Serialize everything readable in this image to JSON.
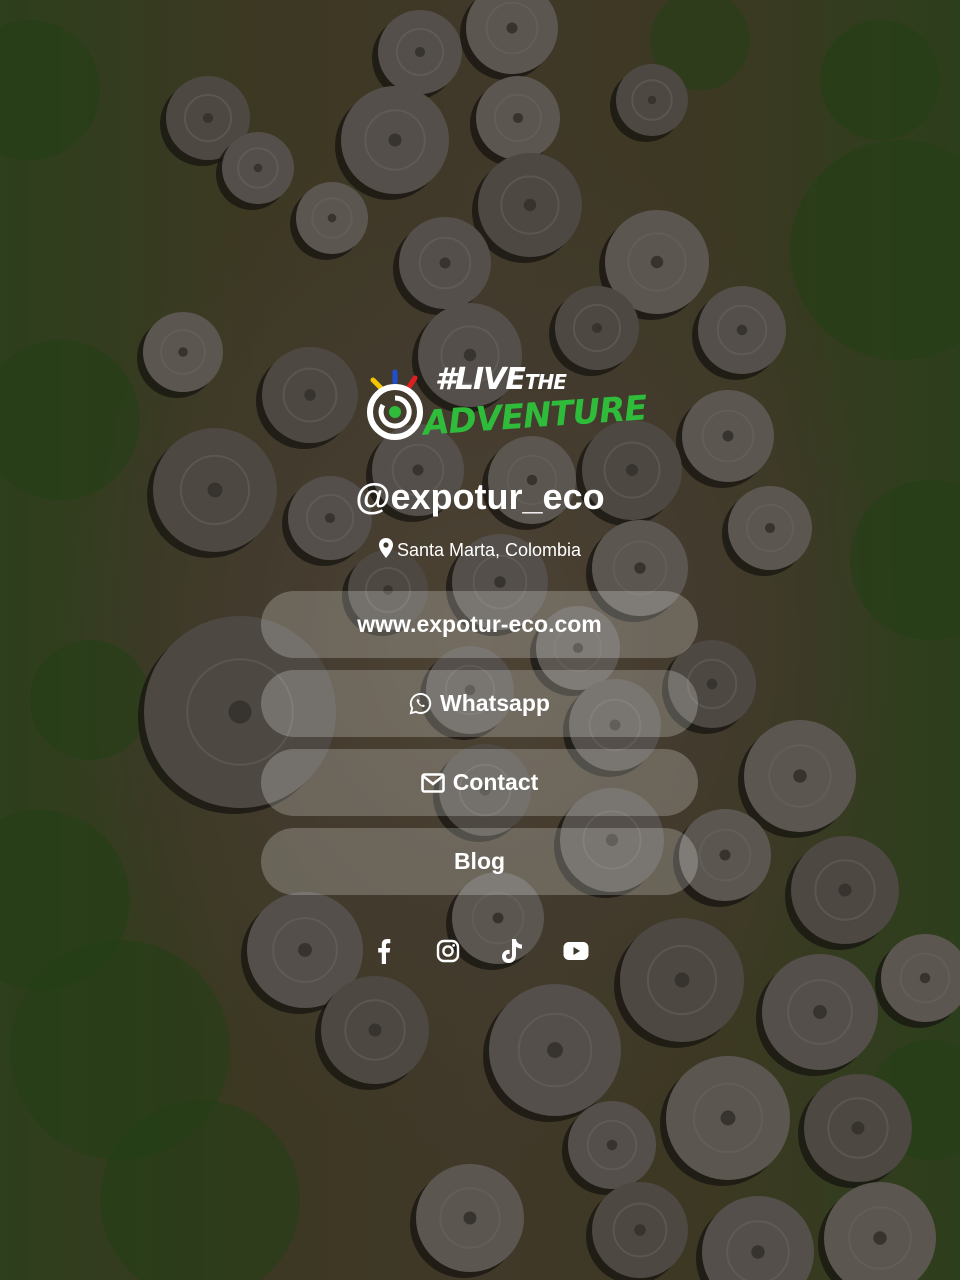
{
  "profile": {
    "logo": {
      "line1": "#LIVE",
      "line1_small": "THE",
      "line2": "ADVENTURE",
      "accent_green": "#2ebc3a"
    },
    "handle": "@expotur_eco",
    "location": "Santa Marta, Colombia",
    "location_icon": "map-pin-icon"
  },
  "links": [
    {
      "label": "www.expotur-eco.com",
      "icon": ""
    },
    {
      "label": "Whatsapp",
      "icon": "whatsapp-icon"
    },
    {
      "label": "Contact",
      "icon": "envelope-icon"
    },
    {
      "label": "Blog",
      "icon": ""
    }
  ],
  "socials": [
    {
      "name": "facebook-icon"
    },
    {
      "name": "instagram-icon"
    },
    {
      "name": "tiktok-icon"
    },
    {
      "name": "youtube-icon"
    }
  ],
  "colors": {
    "button_bg": "rgba(255,255,255,0.22)",
    "text": "#ffffff"
  }
}
